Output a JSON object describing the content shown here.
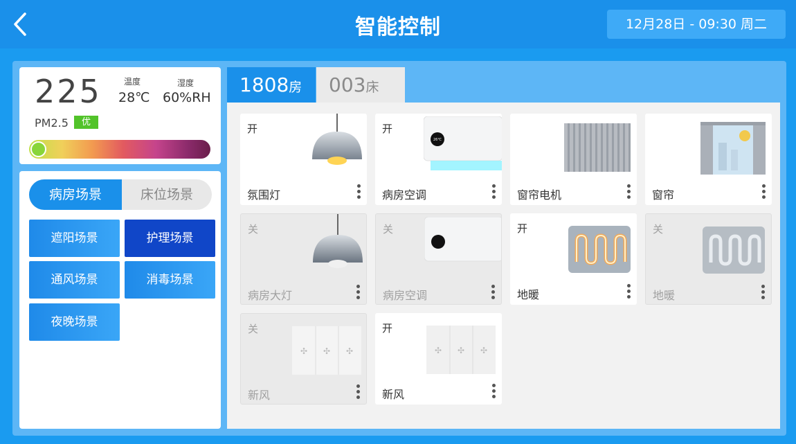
{
  "header": {
    "title": "智能控制",
    "datetime": "12月28日 - 09:30   周二"
  },
  "env": {
    "aqi": "225",
    "temp_label": "温度",
    "temp_value": "28℃",
    "humidity_label": "湿度",
    "humidity_value": "60%RH",
    "pm_label": "PM2.5",
    "pm_grade": "优"
  },
  "scenes": {
    "toggle": {
      "active": "病房场景",
      "inactive": "床位场景"
    },
    "buttons": [
      "遮阳场景",
      "护理场景",
      "通风场景",
      "消毒场景",
      "夜晚场景"
    ]
  },
  "room": {
    "room_no": "1808",
    "room_unit": "房",
    "bed_no": "003",
    "bed_unit": "床"
  },
  "devices": [
    {
      "state": "开",
      "name": "氛围灯"
    },
    {
      "state": "开",
      "name": "病房空调",
      "ac_display": "26℃"
    },
    {
      "state": "",
      "name": "窗帘电机"
    },
    {
      "state": "",
      "name": "窗帘"
    },
    {
      "state": "关",
      "name": "病房大灯"
    },
    {
      "state": "关",
      "name": "病房空调"
    },
    {
      "state": "开",
      "name": "地暖"
    },
    {
      "state": "关",
      "name": "地暖"
    },
    {
      "state": "关",
      "name": "新风"
    },
    {
      "state": "开",
      "name": "新风"
    }
  ],
  "colors": {
    "primary": "#1a90ea",
    "active_scene": "#1046c8",
    "badge": "#52c32a"
  }
}
